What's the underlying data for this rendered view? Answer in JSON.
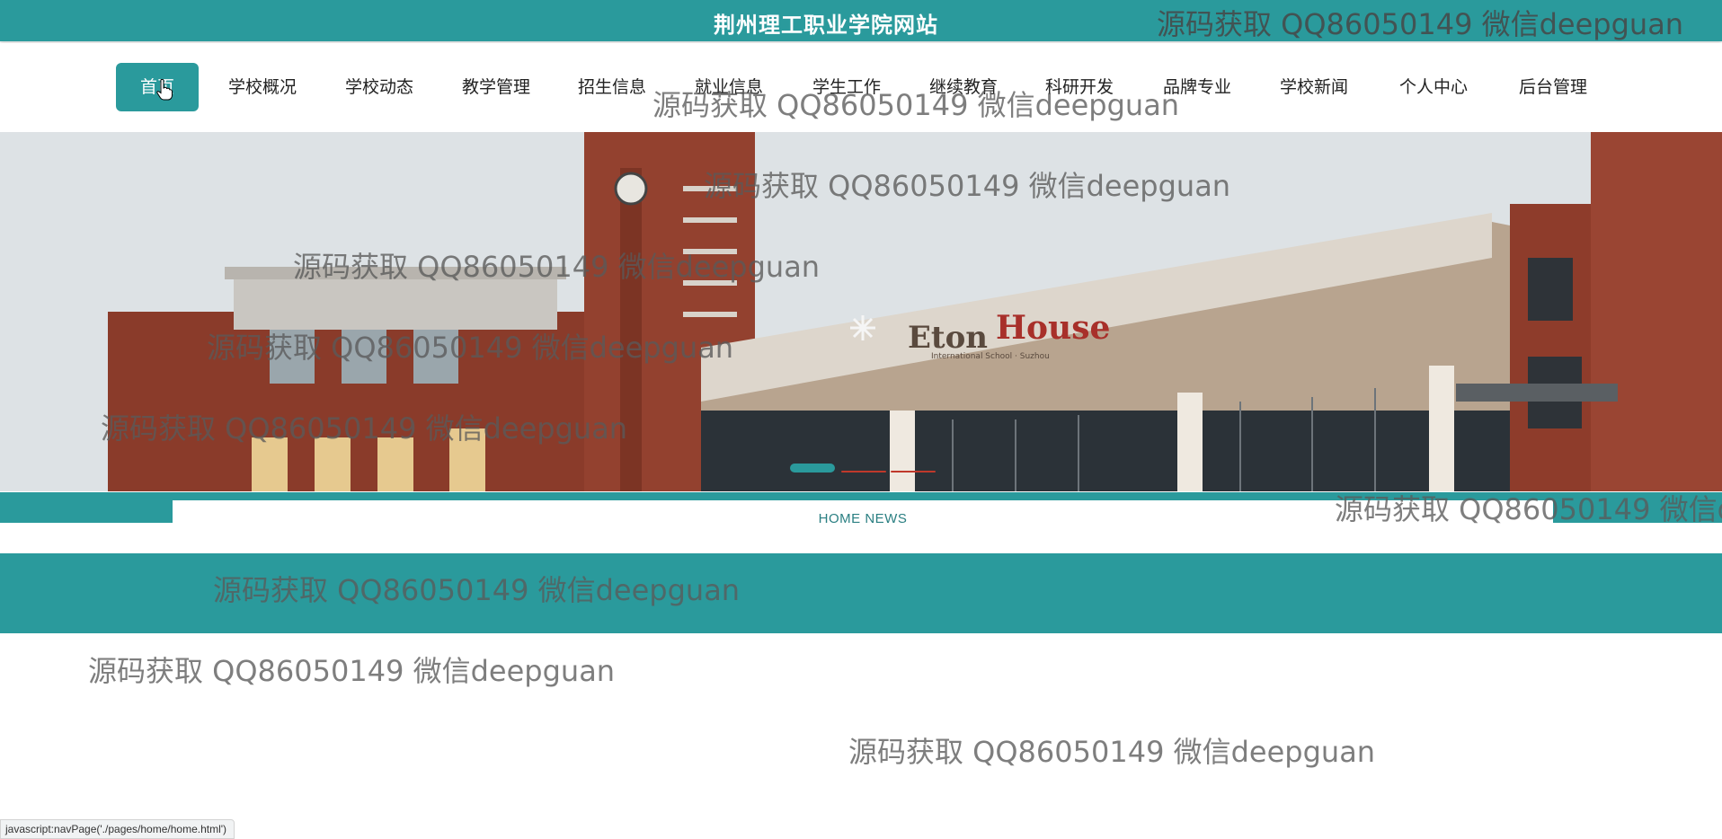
{
  "header": {
    "site_title": "荆州理工职业学院网站"
  },
  "nav": {
    "items": [
      {
        "label": "首页",
        "active": true
      },
      {
        "label": "学校概况"
      },
      {
        "label": "学校动态"
      },
      {
        "label": "教学管理"
      },
      {
        "label": "招生信息"
      },
      {
        "label": "就业信息"
      },
      {
        "label": "学生工作"
      },
      {
        "label": "继续教育"
      },
      {
        "label": "科研开发"
      },
      {
        "label": "品牌专业"
      },
      {
        "label": "学校新闻"
      },
      {
        "label": "个人中心"
      },
      {
        "label": "后台管理"
      }
    ]
  },
  "banner": {
    "sign_text_1": "Eton",
    "sign_text_2": "House",
    "sign_subtitle": "International School · Suzhou",
    "carousel": {
      "slides": 3,
      "active_index": 1
    }
  },
  "news": {
    "title": "HOME NEWS"
  },
  "watermark": "源码获取 QQ86050149 微信deepguan",
  "statusbar": {
    "text": "javascript:navPage('./pages/home/home.html')"
  },
  "colors": {
    "primary": "#2a9a9c",
    "dot_inactive": "#c0392b"
  }
}
